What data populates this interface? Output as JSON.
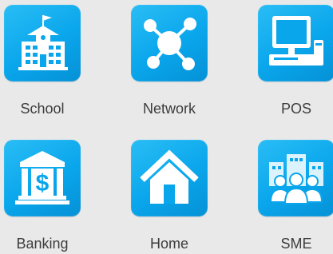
{
  "tiles": [
    {
      "label": "School",
      "icon": "school-icon"
    },
    {
      "label": "Network",
      "icon": "network-icon"
    },
    {
      "label": "POS",
      "icon": "pos-terminal-icon"
    },
    {
      "label": "Banking",
      "icon": "bank-icon"
    },
    {
      "label": "Home",
      "icon": "home-icon"
    },
    {
      "label": "SME",
      "icon": "sme-group-icon"
    }
  ],
  "colors": {
    "background": "#e9e9e9",
    "tile": "#0aa6ec",
    "label": "#3c3c3c"
  }
}
